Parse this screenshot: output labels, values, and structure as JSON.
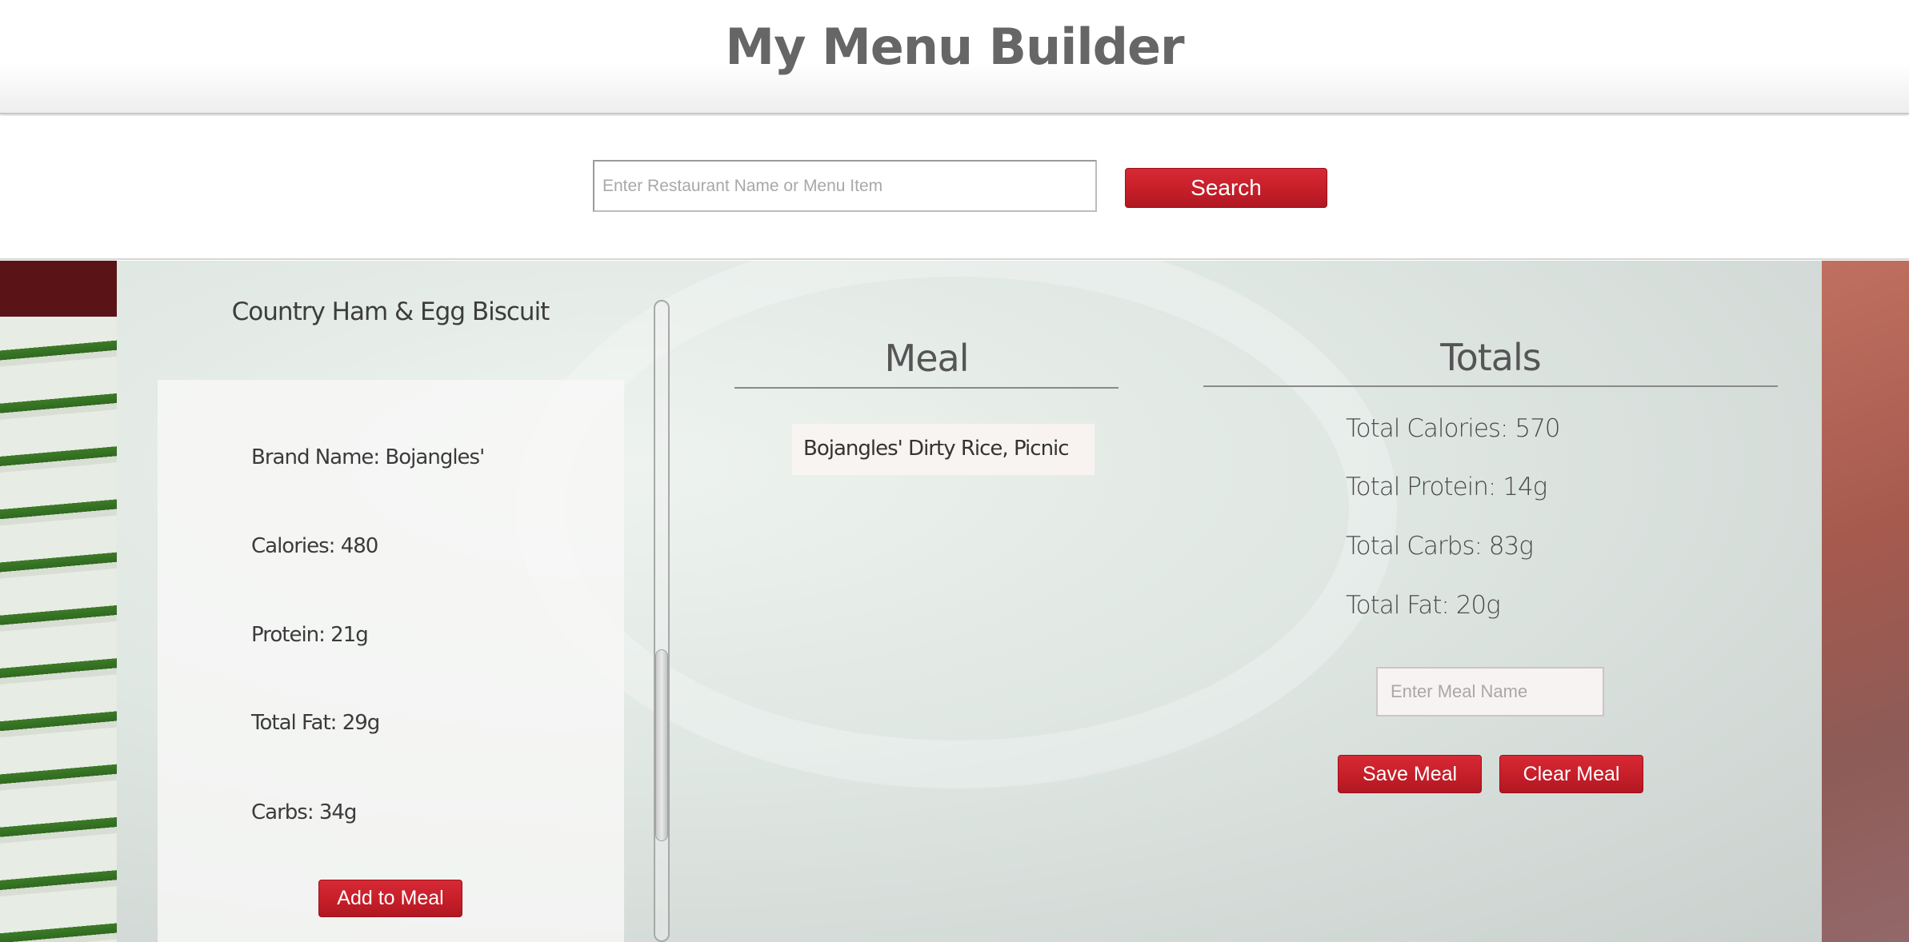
{
  "header": {
    "title": "My Menu Builder"
  },
  "search": {
    "placeholder": "Enter Restaurant Name or Menu Item",
    "button_label": "Search"
  },
  "item_details": {
    "name": "Country Ham & Egg Biscuit",
    "brand": "Brand Name: Bojangles'",
    "calories": "Calories: 480",
    "protein": "Protein: 21g",
    "fat": "Total Fat: 29g",
    "carbs": "Carbs: 34g",
    "add_button_label": "Add to Meal"
  },
  "meal": {
    "heading": "Meal",
    "items": [
      "Bojangles' Dirty Rice, Picnic"
    ]
  },
  "totals": {
    "heading": "Totals",
    "calories": "Total Calories: 570",
    "protein": "Total Protein: 14g",
    "carbs": "Total Carbs: 83g",
    "fat": "Total Fat: 20g",
    "meal_name_placeholder": "Enter Meal Name",
    "save_label": "Save Meal",
    "clear_label": "Clear Meal"
  },
  "colors": {
    "accent": "#c81f2a",
    "heading_text": "#666666"
  }
}
